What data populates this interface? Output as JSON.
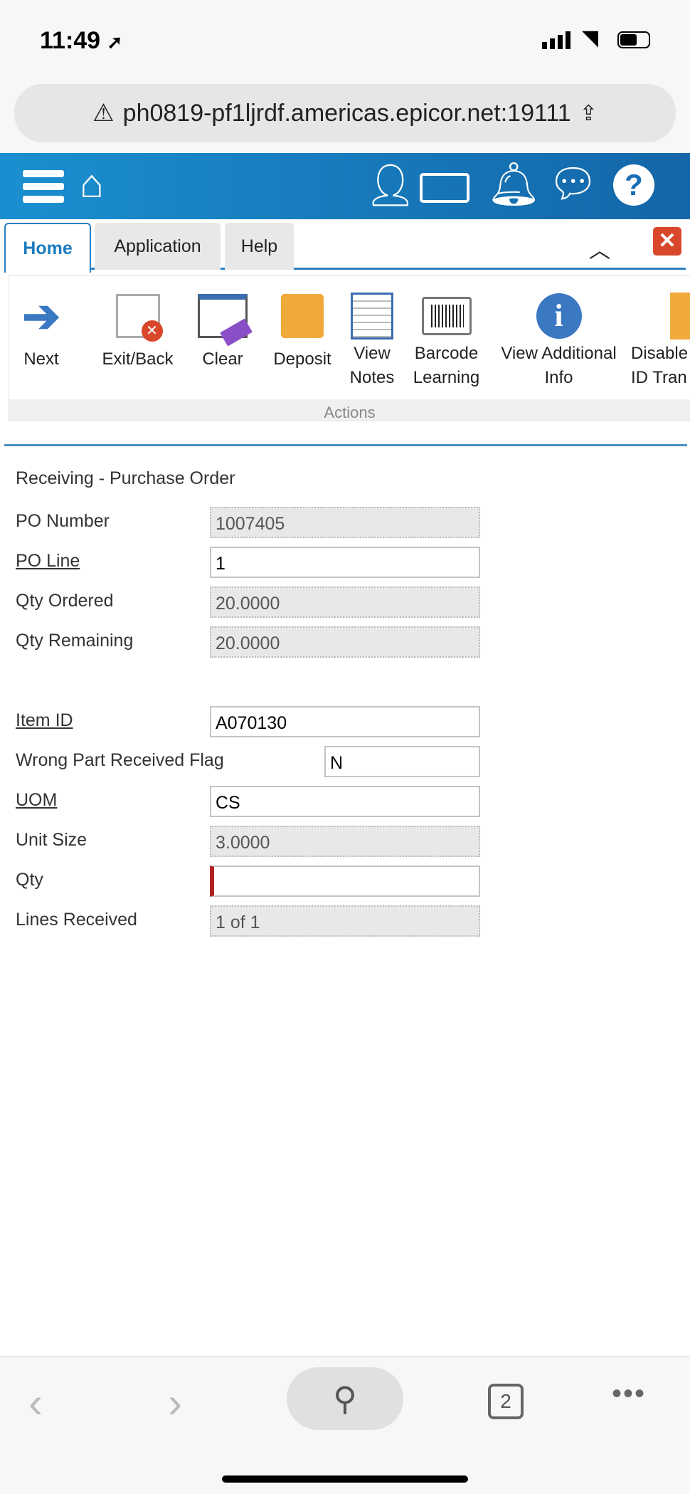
{
  "status_bar": {
    "time": "11:49"
  },
  "browser": {
    "url": "ph0819-pf1ljrdf.americas.epicor.net:19111",
    "tab_count": "2"
  },
  "tabs": [
    {
      "label": "Home",
      "active": true
    },
    {
      "label": "Application"
    },
    {
      "label": "Help"
    }
  ],
  "ribbon": {
    "buttons": [
      {
        "label": "Next",
        "icon": "arrow-right-icon"
      },
      {
        "label": "Exit/Back",
        "icon": "exit-icon"
      },
      {
        "label": "Clear",
        "icon": "eraser-icon"
      },
      {
        "label": "Deposit",
        "icon": "deposit-icon"
      },
      {
        "label": "View Notes",
        "icon": "notes-icon"
      },
      {
        "label": "Barcode Learning",
        "icon": "barcode-icon"
      },
      {
        "label": "View Additional Info",
        "icon": "info-icon"
      },
      {
        "label": "Disable ID Tran",
        "icon": "scroll-icon"
      }
    ],
    "group_label": "Actions"
  },
  "form": {
    "title": "Receiving - Purchase Order",
    "fields": [
      {
        "label": "PO Number",
        "value": "1007405"
      },
      {
        "label": "PO Line",
        "value": "1"
      },
      {
        "label": "Qty Ordered",
        "value": "20.0000"
      },
      {
        "label": "Qty Remaining",
        "value": "20.0000"
      },
      {
        "label": "Item ID",
        "value": "A070130"
      },
      {
        "label": "Wrong Part Received Flag",
        "value": "N"
      },
      {
        "label": "UOM",
        "value": "CS"
      },
      {
        "label": "Unit Size",
        "value": "3.0000"
      },
      {
        "label": "Qty",
        "value": ""
      },
      {
        "label": "Lines Received",
        "value": "1 of 1"
      }
    ]
  },
  "colors": {
    "header": "#1a7bc0",
    "close": "#d9472b",
    "required": "#b22222"
  }
}
